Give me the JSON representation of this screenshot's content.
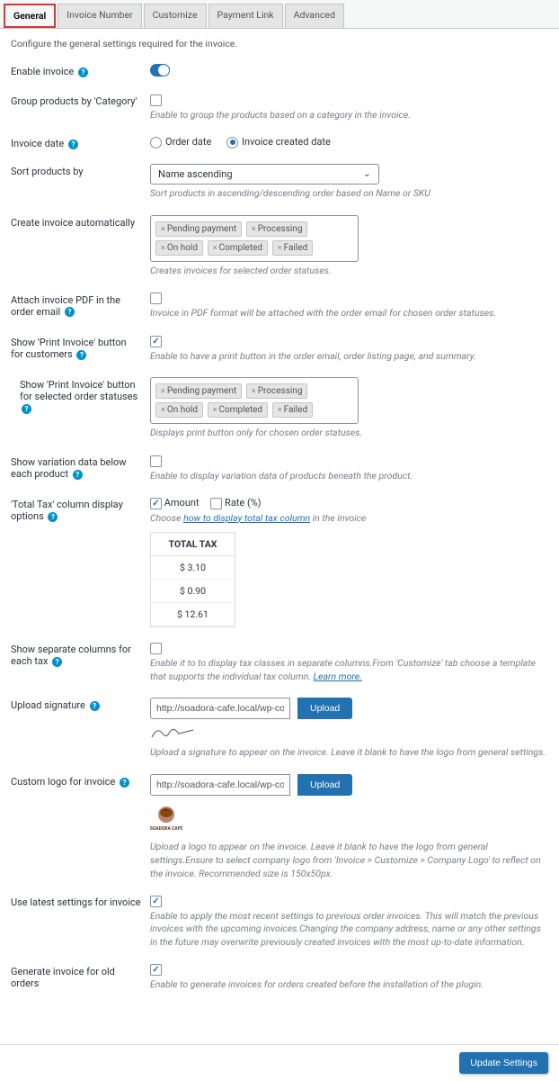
{
  "tabs": [
    "General",
    "Invoice Number",
    "Customize",
    "Payment Link",
    "Advanced"
  ],
  "intro": "Configure the general settings required for the invoice.",
  "labels": {
    "enable": "Enable invoice",
    "group": "Group products by 'Category'",
    "group_hint": "Enable to group the products based on a category in the invoice.",
    "inv_date": "Invoice date",
    "order_date": "Order date",
    "created_date": "Invoice created date",
    "sort": "Sort products by",
    "sort_val": "Name ascending",
    "sort_hint": "Sort products in ascending/descending order based on Name or SKU",
    "auto": "Create invoice automatically",
    "auto_hint": "Creates invoices for selected order statuses.",
    "attach": "Attach invoice PDF in the order email",
    "attach_hint": "Invoice in PDF format will be attached with the order email for chosen order statuses.",
    "print_btn": "Show 'Print Invoice' button for customers",
    "print_hint": "Enable to have a print button in the order email, order listing page, and summary.",
    "print_status": "Show 'Print Invoice' button for selected order statuses",
    "print_status_hint": "Displays print button only for chosen order statuses.",
    "variation": "Show variation data below each product",
    "variation_hint": "Enable to display variation data of products beneath the product.",
    "total_tax": "'Total Tax' column display options",
    "amount": "Amount",
    "rate": "Rate (%)",
    "tax_hint1": "Choose ",
    "tax_link": "how to display total tax column",
    "tax_hint2": " in the invoice",
    "tax_header": "TOTAL TAX",
    "tax_r1": "$ 3.10",
    "tax_r2": "$ 0.90",
    "tax_r3": "$ 12.61",
    "sep_tax": "Show separate columns for each tax",
    "sep_tax_hint": "Enable it to to display tax classes in separate columns.From 'Customize' tab choose a template that supports the individual tax column. ",
    "learn": "Learn more.",
    "upload_sig": "Upload signature",
    "sig_val": "http://soadora-cafe.local/wp-content/up",
    "upload": "Upload",
    "sig_hint": "Upload a signature to appear on the invoice. Leave it blank to have the logo from general settings.",
    "logo": "Custom logo for invoice",
    "logo_val": "http://soadora-cafe.local/wp-content/up",
    "logo_hint": "Upload a logo to appear on the invoice. Leave it blank to have the logo from general settings.Ensure to select company logo from 'Invoice > Customize > Company Logo' to reflect on the invoice. Recommended size is 150x50px.",
    "latest": "Use latest settings for invoice",
    "latest_hint": "Enable to apply the most recent settings to previous order invoices. This will match the previous invoices with the upcoming invoices.Changing the company address, name or any other settings in the future may overwrite previously created invoices with the most up-to-date information.",
    "gen_old": "Generate invoice for old orders",
    "gen_old_hint": "Enable to generate invoices for orders created before the installation of the plugin.",
    "update": "Update Settings"
  },
  "statuses": [
    "Pending payment",
    "Processing",
    "On hold",
    "Completed",
    "Failed"
  ]
}
